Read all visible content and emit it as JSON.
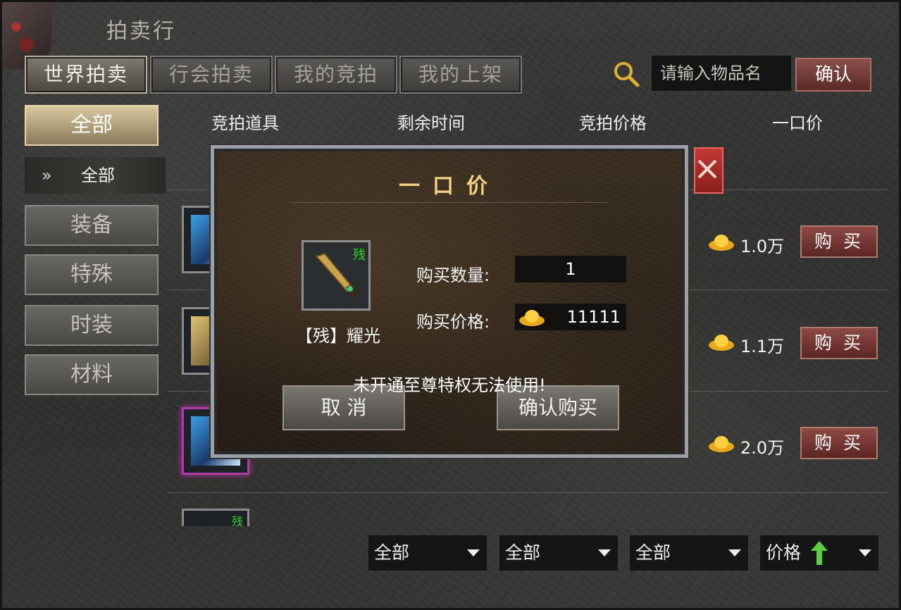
{
  "window": {
    "title": "拍卖行"
  },
  "tabs": [
    {
      "label": "世界拍卖",
      "active": true
    },
    {
      "label": "行会拍卖",
      "active": false
    },
    {
      "label": "我的竞拍",
      "active": false
    },
    {
      "label": "我的上架",
      "active": false
    }
  ],
  "search": {
    "placeholder": "请输入物品名",
    "value": "",
    "confirm_label": "确认"
  },
  "sidebar": {
    "items": [
      {
        "label": "全部",
        "active": true
      },
      {
        "label": "装备"
      },
      {
        "label": "特殊"
      },
      {
        "label": "时装"
      },
      {
        "label": "材料"
      }
    ],
    "sub_item": {
      "chevron": "»",
      "label": "全部"
    }
  },
  "list": {
    "columns": [
      "竞拍道具",
      "剩余时间",
      "竞拍价格",
      "一口价"
    ],
    "rows": [
      {
        "buyout": "1.0万",
        "buy_label": "购 买",
        "icon": "gold-ingot-icon"
      },
      {
        "buyout": "1.1万",
        "buy_label": "购 买",
        "icon": "gold-ingot-icon"
      },
      {
        "buyout": "2.0万",
        "buy_label": "购 买",
        "icon": "gold-ingot-icon"
      }
    ],
    "partial_row_tag": "残"
  },
  "filters": [
    {
      "label": "全部"
    },
    {
      "label": "全部"
    },
    {
      "label": "全部"
    },
    {
      "label": "价格",
      "sort_icon": "arrow-up-icon"
    }
  ],
  "modal": {
    "title": "一口价",
    "item": {
      "name": "【残】耀光",
      "tag": "残",
      "icon": "dagger-icon"
    },
    "quantity_label": "购买数量:",
    "quantity_value": "1",
    "price_label": "购买价格:",
    "price_value": "11111",
    "warning": "未开通至尊特权无法使用!",
    "cancel_label": "取 消",
    "confirm_label": "确认购买"
  },
  "colors": {
    "accent_gold": "#f0d080",
    "buy_button": "#8e4a45",
    "close_button": "#c03a34",
    "rare_border": "#b03aa8",
    "residual_tag": "#30d030"
  }
}
